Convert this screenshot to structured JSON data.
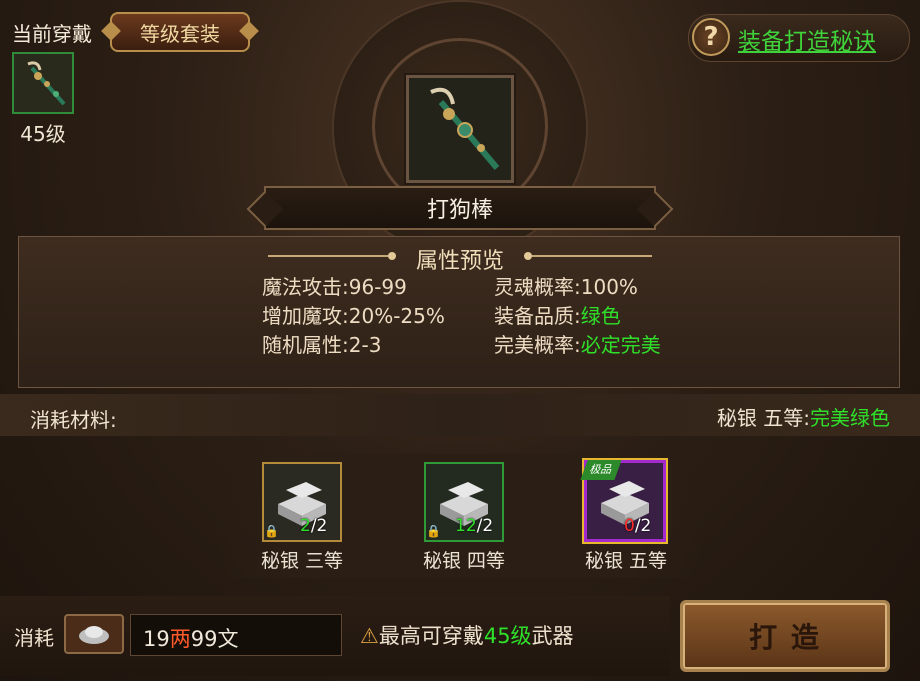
{
  "header": {
    "current_label": "当前穿戴",
    "tier_button": "等级套装",
    "current_level": "45级",
    "help_link": "装备打造秘诀",
    "help_icon": "question-mark-icon"
  },
  "item": {
    "name": "打狗棒",
    "icon": "staff-icon"
  },
  "attributes": {
    "title": "属性预览",
    "left": [
      {
        "label": "魔法攻击:",
        "value": "96-99"
      },
      {
        "label": "增加魔攻:",
        "value": "20%-25%"
      },
      {
        "label": "随机属性:",
        "value": "2-3"
      }
    ],
    "right": [
      {
        "label": "灵魂概率:",
        "value": "100%"
      },
      {
        "label": "装备品质:",
        "value": "绿色"
      },
      {
        "label": "完美概率:",
        "value": "必定完美"
      }
    ]
  },
  "materials": {
    "label": "消耗材料:",
    "selected_name": "秘银 五等:",
    "selected_quality": "完美绿色",
    "items": [
      {
        "name": "秘银 三等",
        "have": "2",
        "need": "/2",
        "border": "#b58a3a",
        "have_color": "#2fe02a",
        "locked": true
      },
      {
        "name": "秘银 四等",
        "have": "12",
        "need": "/2",
        "border": "#2f9a36",
        "have_color": "#2fe02a",
        "locked": true
      },
      {
        "name": "秘银 五等",
        "have": "0",
        "need": "/2",
        "border": "#a42ad0",
        "have_color": "#ff2a2a",
        "locked": false,
        "tag": "极品"
      }
    ]
  },
  "footer": {
    "cost_label": "消耗",
    "coin_icon": "silver-ingot-icon",
    "money_num1": "19",
    "money_unit1": "两",
    "money_num2": "99",
    "money_unit2": "文",
    "warn_prefix": "最高可穿戴",
    "warn_level": "45级",
    "warn_suffix": "武器",
    "forge_button": "打    造",
    "warn_icon": "warning-icon"
  },
  "colors": {
    "green": "#2fe02a",
    "red": "#ff2a2a",
    "gold": "#b98e4b"
  }
}
